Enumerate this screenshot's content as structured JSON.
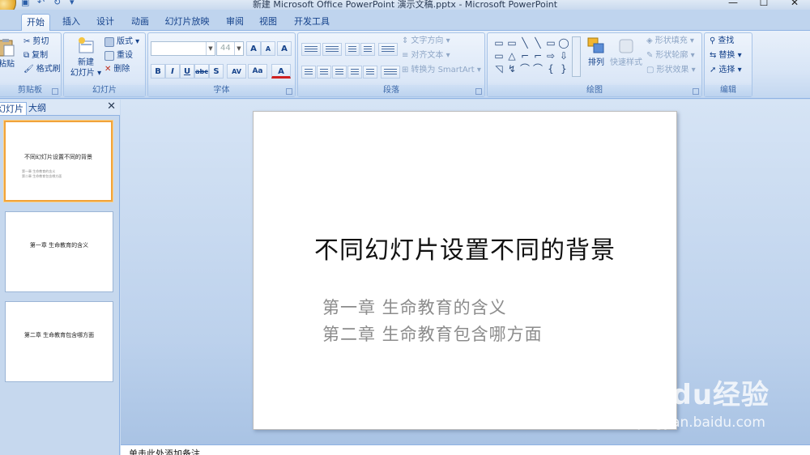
{
  "window": {
    "title": "新建 Microsoft Office PowerPoint 演示文稿.pptx - Microsoft PowerPoint",
    "controls": [
      "—",
      "☐",
      "✕"
    ]
  },
  "tabs": [
    {
      "label": "开始",
      "active": true
    },
    {
      "label": "插入"
    },
    {
      "label": "设计"
    },
    {
      "label": "动画"
    },
    {
      "label": "幻灯片放映"
    },
    {
      "label": "审阅"
    },
    {
      "label": "视图"
    },
    {
      "label": "开发工具"
    }
  ],
  "ribbon": {
    "clipboard": {
      "label": "剪贴板",
      "paste": "粘贴",
      "cut": "剪切",
      "copy": "复制",
      "format_painter": "格式刷"
    },
    "slides": {
      "label": "幻灯片",
      "new_slide_1": "新建",
      "new_slide_2": "幻灯片 ▾",
      "layout": "版式 ▾",
      "reset": "重设",
      "delete": "删除"
    },
    "font": {
      "label": "字体",
      "font_name": "",
      "font_size": "44",
      "grow": "A",
      "shrink": "A",
      "clear": "A",
      "bold": "B",
      "italic": "I",
      "underline": "U",
      "strike": "abc",
      "shadow": "S",
      "spacing": "AV",
      "case": "Aa",
      "color": "A"
    },
    "paragraph": {
      "label": "段落",
      "text_direction": "文字方向 ▾",
      "align_text": "对齐文本 ▾",
      "smartart": "转换为 SmartArt ▾"
    },
    "drawing": {
      "label": "绘图",
      "arrange": "排列",
      "quick_styles": "快速样式",
      "shape_fill": "形状填充 ▾",
      "shape_outline": "形状轮廓 ▾",
      "shape_effects": "形状效果 ▾",
      "shapes": [
        "▭",
        "▭",
        "╲",
        "╲",
        "▭",
        "◯",
        "▭",
        "△",
        "⌐",
        "⌐",
        "⇨",
        "⇩",
        "◹",
        "↯",
        "⌒",
        "⌒",
        "{",
        "}"
      ]
    },
    "editing": {
      "label": "编辑",
      "find": "查找",
      "replace": "替换 ▾",
      "select": "选择 ▾"
    }
  },
  "left_pane": {
    "tab_slides": "幻灯片",
    "tab_outline": "大纲",
    "close": "✕",
    "thumbnails": [
      {
        "title": "不同幻灯片设置不同的背景",
        "subs": [
          "第一章 生命教育的含义",
          "第二章 生命教育包含哪方面"
        ]
      },
      {
        "title": "第一章 生命教育的含义",
        "subs": []
      },
      {
        "title": "第二章 生命教育包含哪方面",
        "subs": []
      }
    ]
  },
  "slide": {
    "title": "不同幻灯片设置不同的背景",
    "bullet_1": "第一章 生命教育的含义",
    "bullet_2": "第二章 生命教育包含哪方面"
  },
  "notes": {
    "placeholder": "单击此处添加备注"
  },
  "watermark": {
    "logo": "Baidu经验",
    "url": "jingyan.baidu.com"
  }
}
